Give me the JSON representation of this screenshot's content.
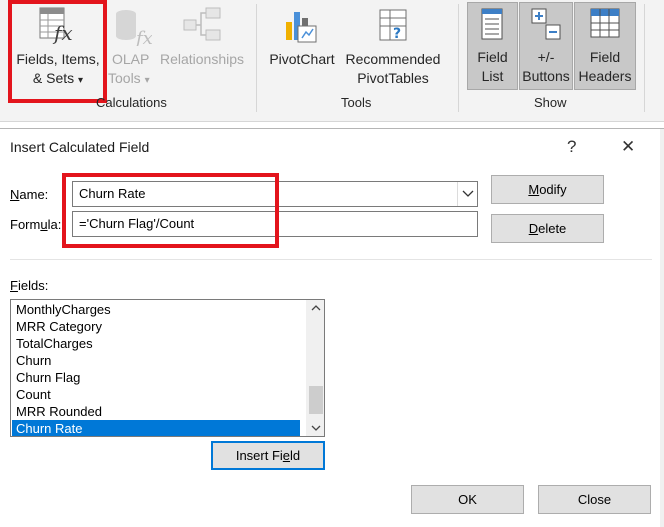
{
  "ribbon": {
    "fields_items_sets": {
      "line1": "Fields, Items,",
      "line2": "& Sets",
      "dropdown": "▾",
      "icon": "fx-table-icon"
    },
    "olap_tools": {
      "line1": "OLAP",
      "line2": "Tools",
      "dropdown": "▾",
      "icon": "olap-cube-icon"
    },
    "relationships": {
      "label": "Relationships",
      "icon": "relationships-icon"
    },
    "calculations_group": "Calculations",
    "pivotchart": {
      "label": "PivotChart",
      "icon": "pivotchart-icon"
    },
    "recommended": {
      "line1": "Recommended",
      "line2": "PivotTables",
      "icon": "recommended-pivottables-icon"
    },
    "tools_group": "Tools",
    "field_list": {
      "line1": "Field",
      "line2": "List",
      "icon": "field-list-icon"
    },
    "buttons": {
      "line1": "+/-",
      "line2": "Buttons",
      "icon": "plus-minus-buttons-icon"
    },
    "field_headers": {
      "line1": "Field",
      "line2": "Headers",
      "icon": "field-headers-icon"
    },
    "show_group": "Show"
  },
  "dialog": {
    "title": "Insert Calculated Field",
    "help": "?",
    "close": "✕",
    "name_label": {
      "pre": "",
      "key": "N",
      "post": "ame:"
    },
    "name_value": "Churn Rate",
    "formula_label": {
      "pre": "Form",
      "key": "u",
      "post": "la:"
    },
    "formula_value": "='Churn Flag'/Count",
    "modify": {
      "pre": "",
      "key": "M",
      "post": "odify"
    },
    "delete": {
      "pre": "",
      "key": "D",
      "post": "elete"
    },
    "fields_label": {
      "pre": "",
      "key": "F",
      "post": "ields:"
    },
    "fields": [
      "MonthlyCharges",
      "MRR Category",
      "TotalCharges",
      "Churn",
      "Churn Flag",
      "Count",
      "MRR Rounded",
      "Churn Rate"
    ],
    "selected_field": "Churn Rate",
    "insert_field": {
      "pre": "Insert Fi",
      "key": "e",
      "post": "ld"
    },
    "ok": "OK",
    "cancel": "Close"
  },
  "colors": {
    "highlight": "#e3141c",
    "selection": "#0078d7",
    "ribbon_bg": "#f3f3f3"
  }
}
